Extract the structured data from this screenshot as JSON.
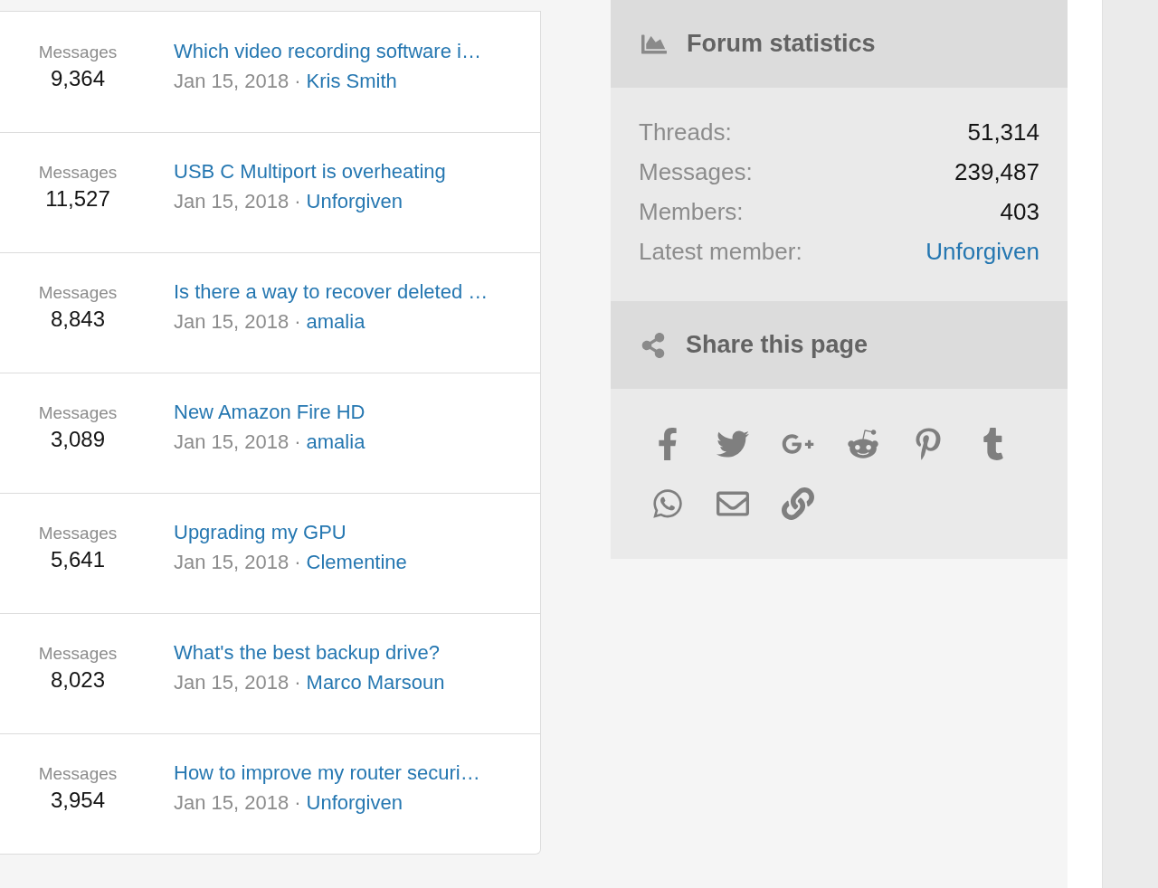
{
  "threads": [
    {
      "count_label": "Messages",
      "count": "9,364",
      "title": "Which video recording software i…",
      "date": "Jan 15, 2018",
      "separator": "·",
      "author": "Kris Smith"
    },
    {
      "count_label": "Messages",
      "count": "11,527",
      "title": "USB C Multiport is overheating",
      "date": "Jan 15, 2018",
      "separator": "·",
      "author": "Unforgiven"
    },
    {
      "count_label": "Messages",
      "count": "8,843",
      "title": "Is there a way to recover deleted …",
      "date": "Jan 15, 2018",
      "separator": "·",
      "author": "amalia"
    },
    {
      "count_label": "Messages",
      "count": "3,089",
      "title": "New Amazon Fire HD",
      "date": "Jan 15, 2018",
      "separator": "·",
      "author": "amalia"
    },
    {
      "count_label": "Messages",
      "count": "5,641",
      "title": "Upgrading my GPU",
      "date": "Jan 15, 2018",
      "separator": "·",
      "author": "Clementine"
    },
    {
      "count_label": "Messages",
      "count": "8,023",
      "title": "What's the best backup drive?",
      "date": "Jan 15, 2018",
      "separator": "·",
      "author": "Marco Marsoun"
    },
    {
      "count_label": "Messages",
      "count": "3,954",
      "title": "How to improve my router securi…",
      "date": "Jan 15, 2018",
      "separator": "·",
      "author": "Unforgiven"
    }
  ],
  "forum_statistics": {
    "title": "Forum statistics",
    "rows": [
      {
        "label": "Threads:",
        "value": "51,314",
        "kind": "text"
      },
      {
        "label": "Messages:",
        "value": "239,487",
        "kind": "text"
      },
      {
        "label": "Members:",
        "value": "403",
        "kind": "text"
      },
      {
        "label": "Latest member:",
        "value": "Unforgiven",
        "kind": "link"
      }
    ]
  },
  "share": {
    "title": "Share this page"
  }
}
